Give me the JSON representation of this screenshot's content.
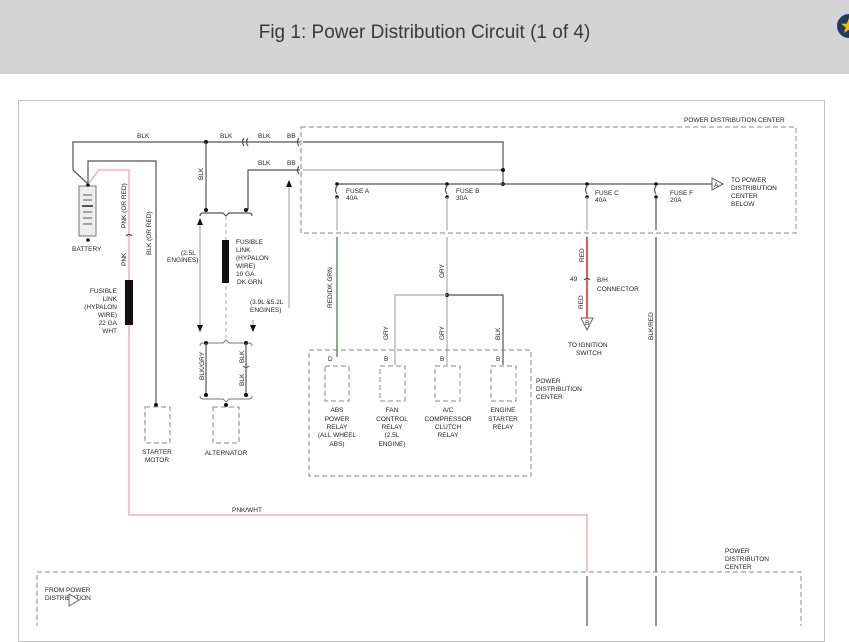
{
  "header": {
    "title": "Fig 1: Power Distribution Circuit (1 of 4)",
    "bookmark_icon": "star-icon"
  },
  "colors": {
    "pink_wire": "#f4a0b4",
    "red_wire": "#e02020",
    "green_wire": "#2e7d32",
    "blk_red_wire": "#7a5050",
    "relay_box_fill": "#f0f0fa",
    "header_bg": "#d4d4d4",
    "star_circle": "#1e3a60",
    "star": "#f2b705"
  },
  "diagram": {
    "pdc_top_label": "POWER DISTRIBUTION CENTER",
    "wires": {
      "blk1": "BLK",
      "blk2": "BLK",
      "blk3": "BLK",
      "bb1": "BB",
      "blk4": "BLK",
      "bb2": "BB",
      "blk_vert": "BLK",
      "pnk_or_red": "PNK (OR RED)",
      "pnk": "PNK",
      "blk_or_red": "BLK (OR RED)",
      "blk_gry": "BLK/GRY",
      "blk_a": "BLK",
      "blk_b": "BLK",
      "red_dk_grn": "RED/DK GRN",
      "gry1": "GRY",
      "gry2": "GRY",
      "gry3": "GRY",
      "blk5": "BLK",
      "red1": "RED",
      "red2": "RED",
      "blk_red": "BLK/RED",
      "pnk_wht": "PNK/WHT"
    },
    "battery": "BATTERY",
    "fusible_22": [
      "FUSIBLE",
      "LINK",
      "(HYPALON",
      "WIRE)",
      "22 GA",
      "WHT"
    ],
    "fusible_10": [
      "FUSIBLE",
      "LINK",
      "(HYPALON",
      "WIRE)",
      "10 GA",
      "DK GRN"
    ],
    "engines_25": [
      "(2.5L",
      "ENGINES)"
    ],
    "engines_39": [
      "(3.9L &5.2L",
      "ENGINES)"
    ],
    "starter": [
      "STARTER",
      "MOTOR"
    ],
    "alternator": "ALTERNATOR",
    "fuses": [
      {
        "name": "FUSE A",
        "rating": "40A"
      },
      {
        "name": "FUSE B",
        "rating": "30A"
      },
      {
        "name": "FUSE C",
        "rating": "40A"
      },
      {
        "name": "FUSE F",
        "rating": "20A"
      }
    ],
    "to_pdc_below": {
      "connector": "A",
      "lines": [
        "TO POWER",
        "DISTRIBUTION",
        "CENTER",
        "BELOW"
      ]
    },
    "bh_connector": {
      "pin": "49",
      "lines": [
        "B/H",
        "CONNECTOR"
      ]
    },
    "ignition": {
      "connector": "B",
      "lines": [
        "TO IGNITION",
        "SWITCH"
      ]
    },
    "relays": [
      {
        "pin": "D",
        "lines": [
          "ABS",
          "POWER",
          "RELAY",
          "(ALL WHEEL",
          "ABS)"
        ]
      },
      {
        "pin": "B",
        "lines": [
          "FAN",
          "CONTROL",
          "RELAY",
          "(2.5L",
          "ENGINE)"
        ]
      },
      {
        "pin": "B",
        "lines": [
          "A/C",
          "COMPRESSOR",
          "CLUTCH",
          "RELAY"
        ]
      },
      {
        "pin": "B",
        "lines": [
          "ENGINE",
          "STARTER",
          "RELAY"
        ]
      }
    ],
    "pdc_relay_label": [
      "POWER",
      "DISTRIBUTION",
      "CENTER"
    ],
    "pdc_bottom_label": [
      "POWER",
      "DISTRIBUTON",
      "CENTER"
    ],
    "from_pdc": [
      "FROM POWER",
      "DISTRIBUTION"
    ]
  }
}
